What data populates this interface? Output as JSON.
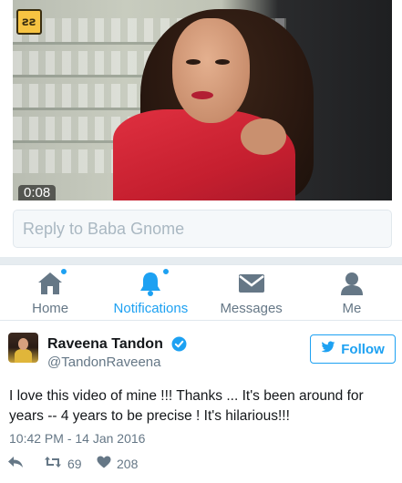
{
  "video": {
    "duration": "0:08",
    "logo_text": "ƨƨ"
  },
  "reply": {
    "placeholder": "Reply to Baba Gnome"
  },
  "tabs": [
    {
      "label": "Home",
      "icon": "home-icon",
      "has_dot": true
    },
    {
      "label": "Notifications",
      "icon": "bell-icon",
      "has_dot": true,
      "active": true
    },
    {
      "label": "Messages",
      "icon": "envelope-icon",
      "has_dot": false
    },
    {
      "label": "Me",
      "icon": "person-icon",
      "has_dot": false
    }
  ],
  "tweet": {
    "author": {
      "name": "Raveena Tandon",
      "handle": "@TandonRaveena",
      "verified": true
    },
    "follow_label": "Follow",
    "text": "I love this video of mine !!! Thanks ... It's been around for years -- 4 years to be precise ! It's hilarious!!!",
    "timestamp": "10:42 PM - 14 Jan 2016",
    "retweets": "69",
    "likes": "208"
  },
  "colors": {
    "accent": "#1da1f2",
    "muted": "#657786",
    "text": "#14171a",
    "border": "#e1e8ed"
  }
}
